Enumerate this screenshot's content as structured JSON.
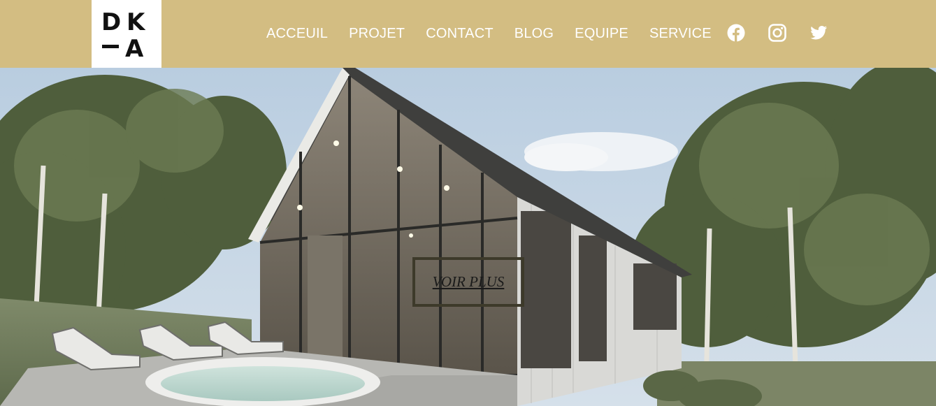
{
  "brand": {
    "logo_text": "DK—A",
    "logo_glyphs": [
      "D",
      "K",
      "A"
    ]
  },
  "nav": {
    "items": [
      {
        "label": "ACCEUIL",
        "name": "nav-acceuil"
      },
      {
        "label": "PROJET",
        "name": "nav-projet"
      },
      {
        "label": "CONTACT",
        "name": "nav-contact"
      },
      {
        "label": "BLOG",
        "name": "nav-blog"
      },
      {
        "label": "EQUIPE",
        "name": "nav-equipe"
      },
      {
        "label": "SERVICE",
        "name": "nav-service"
      }
    ]
  },
  "social": [
    {
      "icon": "facebook-icon"
    },
    {
      "icon": "instagram-icon"
    },
    {
      "icon": "twitter-icon"
    }
  ],
  "hero": {
    "cta_label": "VOIR PLUS"
  },
  "colors": {
    "header_bg": "#d3bd82",
    "logo_bg": "#ffffff",
    "nav_text": "#ffffff",
    "cta_border": "#3d3a2a"
  }
}
